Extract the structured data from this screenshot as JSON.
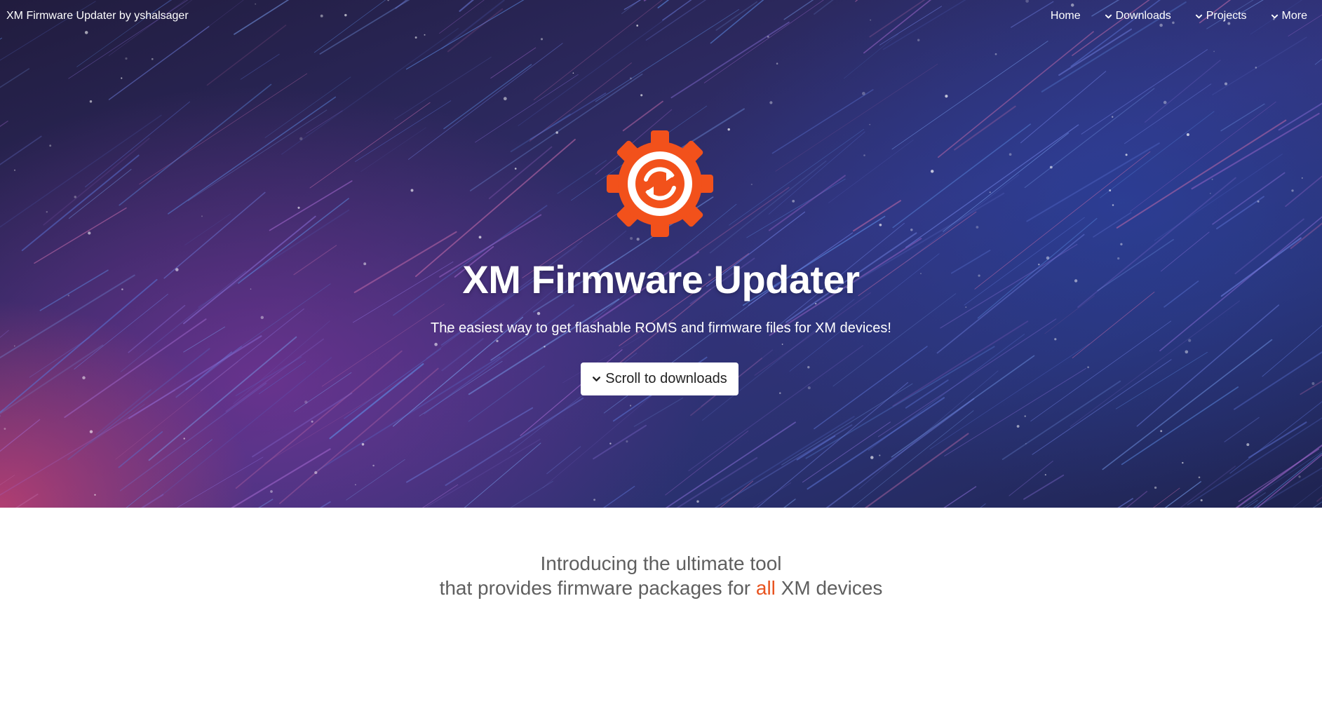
{
  "navbar": {
    "brand": "XM Firmware Updater by yshalsager",
    "items": [
      {
        "label": "Home",
        "has_dropdown": false
      },
      {
        "label": "Downloads",
        "has_dropdown": true
      },
      {
        "label": "Projects",
        "has_dropdown": true
      },
      {
        "label": "More",
        "has_dropdown": true
      }
    ]
  },
  "hero": {
    "logo_icon": "gear-refresh-icon",
    "title": "XM Firmware Updater",
    "subtitle": "The easiest way to get flashable ROMS and firmware files for XM devices!",
    "scroll_button_label": "Scroll to downloads"
  },
  "intro": {
    "line1": "Introducing the ultimate tool",
    "line2_before": "that provides firmware packages for ",
    "line2_accent": "all",
    "line2_after": " XM devices"
  },
  "colors": {
    "accent": "#e8531f",
    "logo_orange": "#f2511b",
    "intro_text": "#5f5f5f"
  }
}
